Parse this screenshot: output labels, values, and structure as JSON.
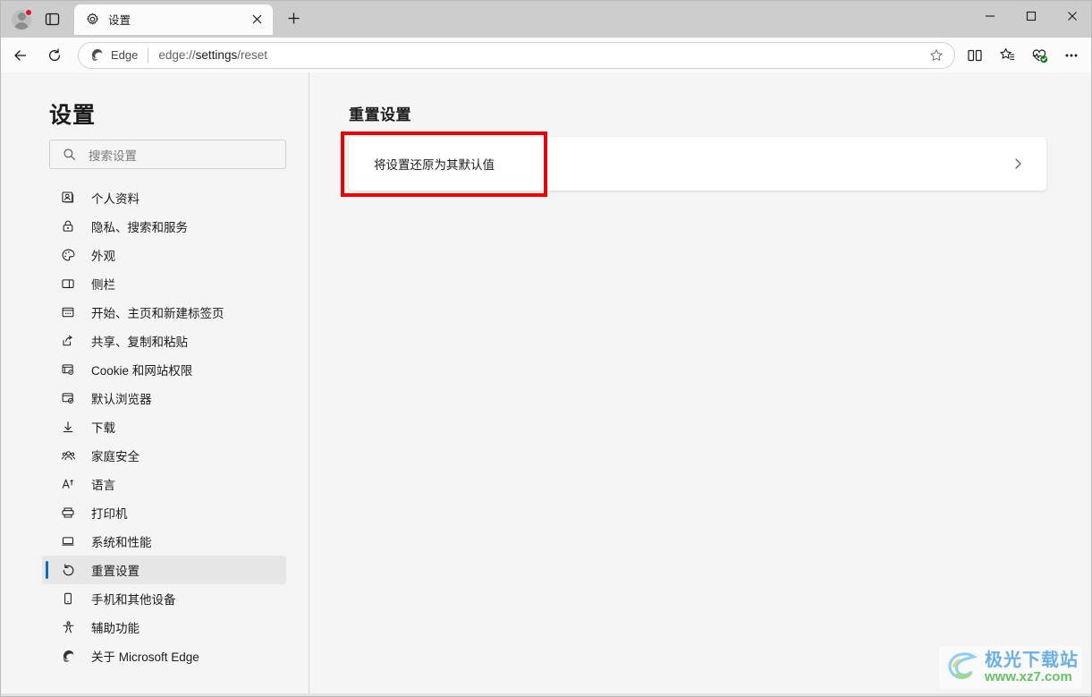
{
  "window": {
    "controls": [
      {
        "name": "minimize",
        "glyph": "minimize-icon"
      },
      {
        "name": "maximize",
        "glyph": "maximize-icon"
      },
      {
        "name": "close",
        "glyph": "close-icon"
      }
    ]
  },
  "tabstrip": {
    "profile_icon": "profile-avatar-icon",
    "tab_actions_icon": "tab-actions-icon",
    "tab": {
      "favicon": "gear-icon",
      "title": "设置",
      "close_icon": "close-icon"
    },
    "new_tab_icon": "plus-icon",
    "new_tab_label": "+"
  },
  "navbar": {
    "back_icon": "back-arrow-icon",
    "refresh_icon": "refresh-icon",
    "omnibox": {
      "brand_icon": "edge-logo-icon",
      "brand_label": "Edge",
      "url_scheme": "edge://",
      "url_host": "settings",
      "url_path": "/reset",
      "url_full": "edge://settings/reset",
      "favorite_icon": "star-outline-icon"
    },
    "tools": [
      {
        "name": "split-screen-icon",
        "label": "split-screen"
      },
      {
        "name": "favorites-icon",
        "label": "favorites"
      },
      {
        "name": "browser-essentials-icon",
        "label": "browser-essentials"
      },
      {
        "name": "settings-more-icon",
        "label": "more"
      }
    ]
  },
  "sidebar": {
    "title": "设置",
    "search": {
      "icon": "search-icon",
      "placeholder": "搜索设置",
      "value": ""
    },
    "items": [
      {
        "icon": "profile-icon",
        "label": "个人资料",
        "selected": false
      },
      {
        "icon": "lock-icon",
        "label": "隐私、搜索和服务",
        "selected": false
      },
      {
        "icon": "palette-icon",
        "label": "外观",
        "selected": false
      },
      {
        "icon": "sidebar-icon",
        "label": "侧栏",
        "selected": false
      },
      {
        "icon": "start-home-icon",
        "label": "开始、主页和新建标签页",
        "selected": false
      },
      {
        "icon": "share-icon",
        "label": "共享、复制和粘贴",
        "selected": false
      },
      {
        "icon": "cookie-permissions-icon",
        "label": "Cookie 和网站权限",
        "selected": false
      },
      {
        "icon": "default-browser-icon",
        "label": "默认浏览器",
        "selected": false
      },
      {
        "icon": "download-icon",
        "label": "下载",
        "selected": false
      },
      {
        "icon": "family-safety-icon",
        "label": "家庭安全",
        "selected": false
      },
      {
        "icon": "language-icon",
        "label": "语言",
        "selected": false
      },
      {
        "icon": "printer-icon",
        "label": "打印机",
        "selected": false
      },
      {
        "icon": "system-performance-icon",
        "label": "系统和性能",
        "selected": false
      },
      {
        "icon": "reset-icon",
        "label": "重置设置",
        "selected": true
      },
      {
        "icon": "phone-devices-icon",
        "label": "手机和其他设备",
        "selected": false
      },
      {
        "icon": "accessibility-icon",
        "label": "辅助功能",
        "selected": false
      },
      {
        "icon": "edge-logo-icon",
        "label": "关于 Microsoft Edge",
        "selected": false
      }
    ]
  },
  "main": {
    "section_title": "重置设置",
    "card": {
      "label": "将设置还原为其默认值",
      "chevron_icon": "chevron-right-icon"
    },
    "annotation": {
      "color": "#ee0000",
      "target": "将设置还原为其默认值"
    }
  },
  "watermark": {
    "logo_icon": "jiguang-logo-icon",
    "cn_text": "极光下载站",
    "url_text": "www.xz7.com"
  },
  "colors": {
    "accent": "#0f6cbd",
    "annotation_red": "#ee0000",
    "titlebar_bg": "#cdcdcd",
    "page_bg": "#f5f5f5",
    "card_bg": "#ffffff",
    "selected_bg": "#e6e6e6"
  }
}
